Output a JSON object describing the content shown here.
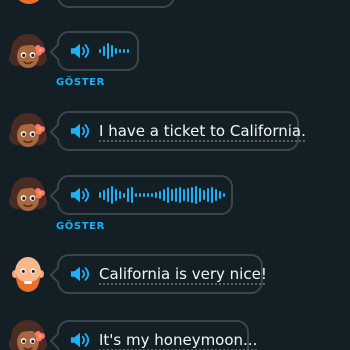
{
  "colors": {
    "background": "#131f24",
    "bubble_border": "#37464f",
    "accent": "#1cb0f6",
    "text": "#f1f7fb"
  },
  "icons": {
    "speaker": "speaker-icon",
    "waveform": "audio-waveform-icon"
  },
  "messages": [
    {
      "speaker": "woman",
      "type": "audio",
      "reveal_label": "GÖSTER"
    },
    {
      "speaker": "woman",
      "type": "text",
      "text": "I have a ticket to California."
    },
    {
      "speaker": "woman",
      "type": "audio",
      "reveal_label": "GÖSTER"
    },
    {
      "speaker": "man",
      "type": "text",
      "text": "California is very nice!"
    },
    {
      "speaker": "woman",
      "type": "text",
      "text": "It's my honeymoon..."
    }
  ]
}
